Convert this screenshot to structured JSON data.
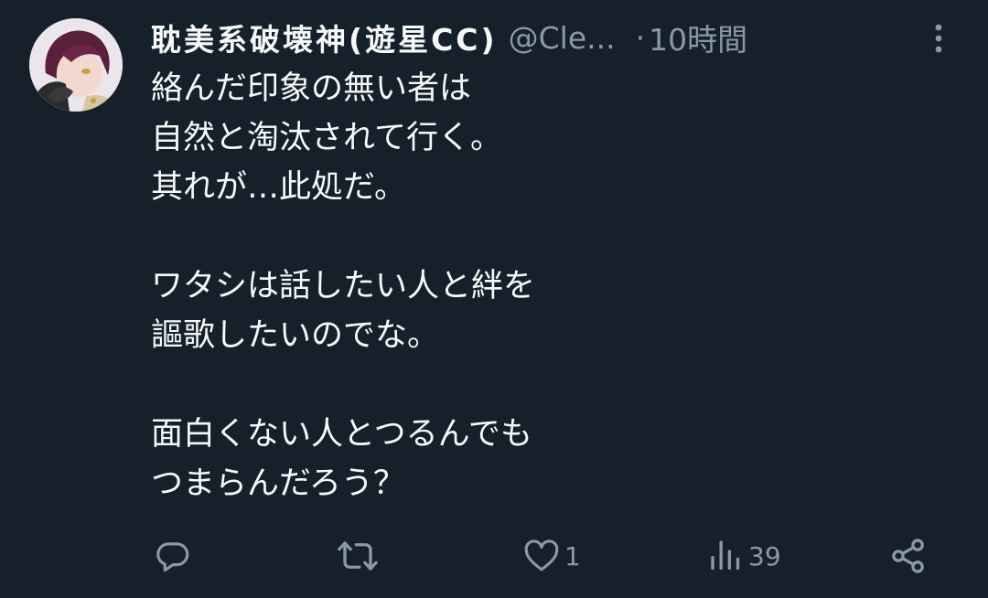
{
  "tweet": {
    "author": {
      "display_name": "耽美系破壊神(遊星CC)",
      "handle": "@Cle...",
      "separator": "·",
      "time": "10時間"
    },
    "text_lines": [
      "絡んだ印象の無い者は",
      "自然と淘汰されて行く。",
      "其れが…此処だ。",
      "",
      "ワタシは話したい人と絆を",
      "謳歌したいのでな。",
      "",
      "面白くない人とつるんでも",
      "つまらんだろう？"
    ],
    "actions": {
      "reply": {
        "icon": "reply-icon",
        "count": ""
      },
      "retweet": {
        "icon": "retweet-icon",
        "count": ""
      },
      "like": {
        "icon": "heart-icon",
        "count": "1"
      },
      "views": {
        "icon": "views-icon",
        "count": "39"
      },
      "share": {
        "icon": "share-icon"
      }
    }
  },
  "colors": {
    "background": "#15202b",
    "text_primary": "#f7f9f9",
    "text_secondary": "#8b98a5"
  }
}
